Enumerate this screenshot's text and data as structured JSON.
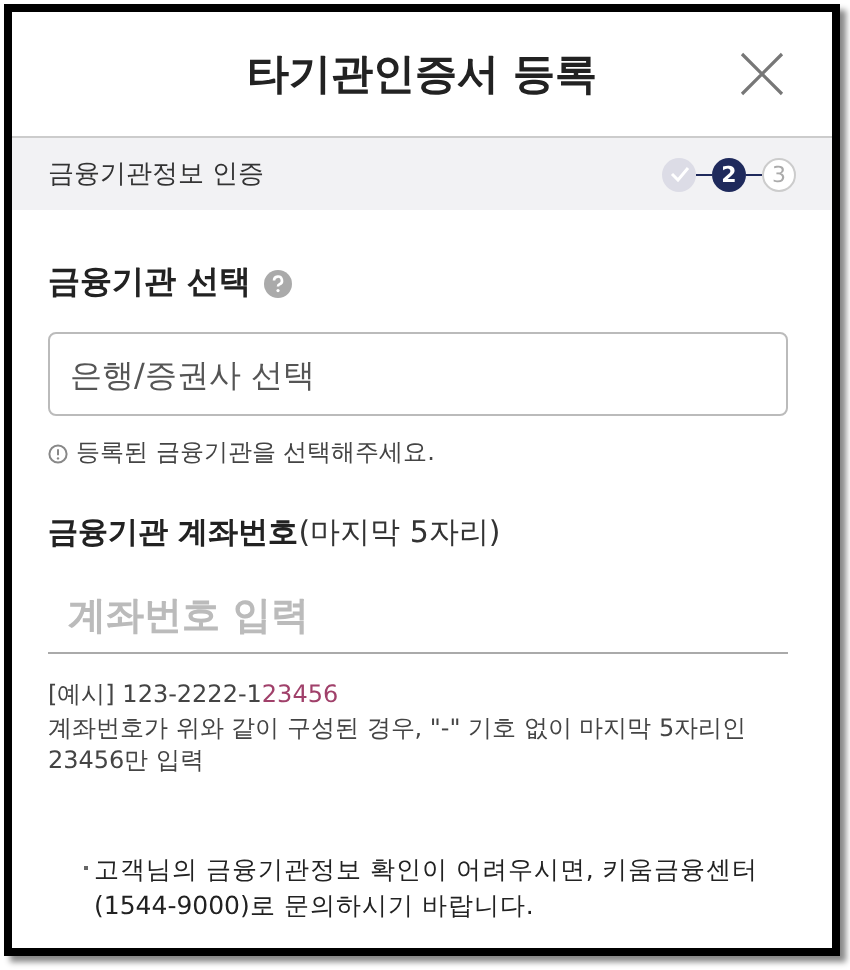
{
  "header": {
    "title": "타기관인증서 등록"
  },
  "step_bar": {
    "label": "금융기관정보 인증",
    "steps": [
      {
        "kind": "done"
      },
      {
        "kind": "current",
        "number": "2"
      },
      {
        "kind": "pending",
        "number": "3"
      }
    ]
  },
  "institution": {
    "title": "금융기관 선택",
    "field": {
      "placeholder": "은행/증권사 선택"
    },
    "hint": "등록된 금융기관을 선택해주세요."
  },
  "account": {
    "title": "**금융기관 계좌번호**(마지막 5자리)",
    "field": {
      "placeholder": "계좌번호 입력"
    },
    "example": [
      {
        "text": "[예시] 123-2222-1",
        "highlight": false
      },
      {
        "text": "23456",
        "highlight": true
      }
    ],
    "description": "계좌번호가 위와 같이 구성된 경우, \"-\" 기호 없이 마지막 5자리인 23456만 입력"
  },
  "notice": "고객님의 금융기관정보 확인이 어려우시면, 키움금융센터 (1544-9000)로 문의하시기 바랍니다."
}
